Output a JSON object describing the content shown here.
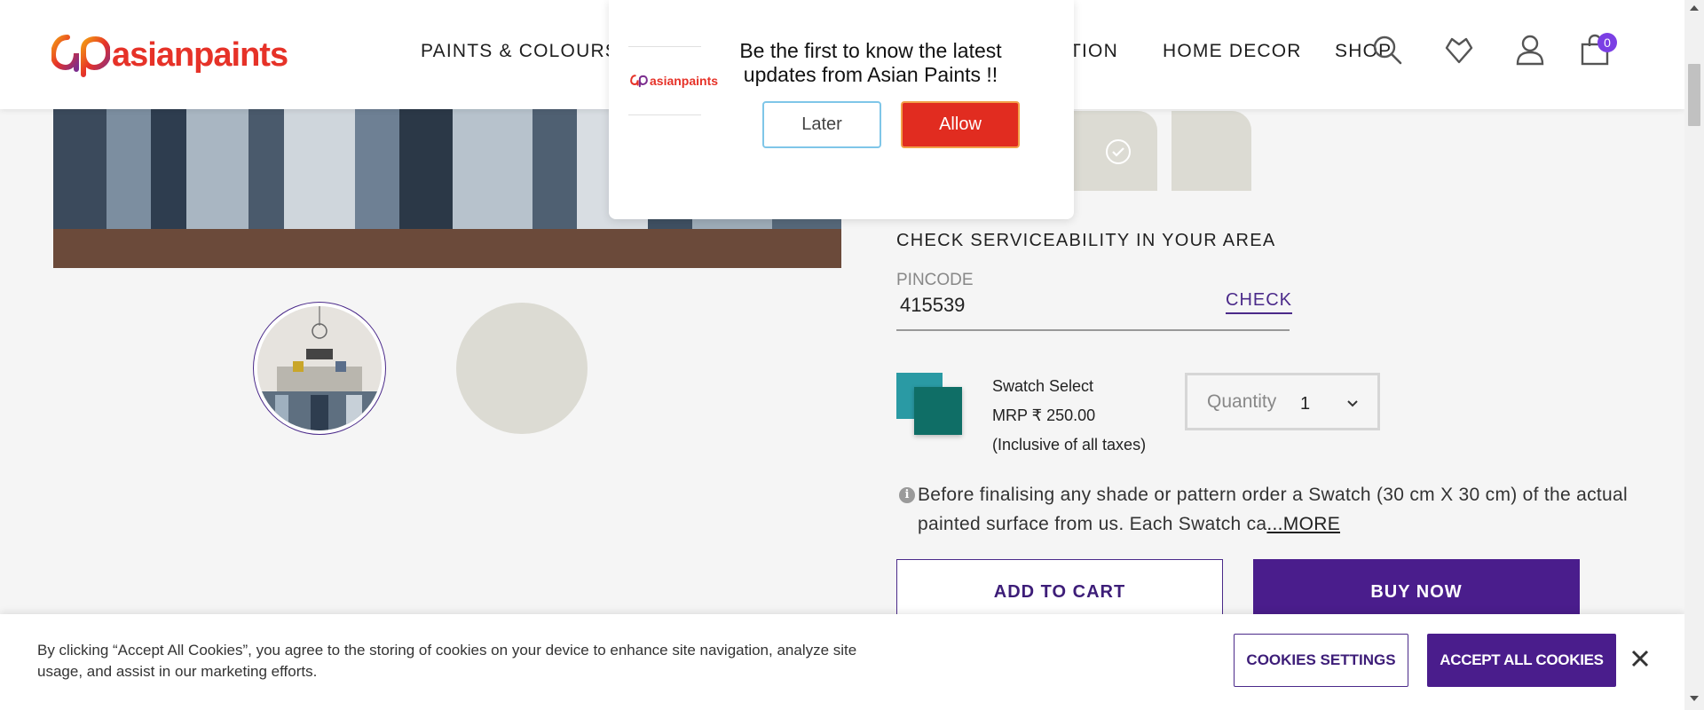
{
  "brand": {
    "name": "asianpaints",
    "color": "#e63228"
  },
  "nav": {
    "items": [
      "PAINTS & COLOURS",
      "TION",
      "HOME DECOR",
      "SHOP"
    ]
  },
  "header_icons": [
    "search-icon",
    "heart-icon",
    "user-icon",
    "cart-icon"
  ],
  "cart": {
    "count": "0"
  },
  "popup": {
    "brand": "asianpaints",
    "message": "Be the first to know the latest updates from Asian Paints !!",
    "later_label": "Later",
    "allow_label": "Allow"
  },
  "serviceability": {
    "title": "CHECK SERVICEABILITY IN YOUR AREA",
    "pincode_label": "PINCODE",
    "pincode_value": "415539",
    "check_label": "CHECK"
  },
  "product": {
    "name": "Swatch Select",
    "price": "MRP ₹ 250.00",
    "tax_note": "(Inclusive of all taxes)",
    "swatch_colors": [
      "#2a9aa4",
      "#0f6e66"
    ]
  },
  "quantity": {
    "label": "Quantity",
    "value": "1"
  },
  "info": {
    "text": "Before finalising any shade or pattern order a Swatch (30 cm X 30 cm) of the actual painted surface from us. Each Swatch ca",
    "more_label": "...MORE"
  },
  "actions": {
    "add_to_cart": "ADD TO CART",
    "buy_now": "BUY NOW"
  },
  "cookie": {
    "text": "By clicking “Accept All Cookies”, you agree to the storing of cookies on your device to enhance site navigation, analyze site usage, and assist in our marketing efforts.",
    "settings_label": "COOKIES SETTINGS",
    "accept_label": "ACCEPT ALL COOKIES"
  },
  "colors": {
    "accent_purple": "#4a1d8c",
    "allow_red": "#e12c20"
  }
}
